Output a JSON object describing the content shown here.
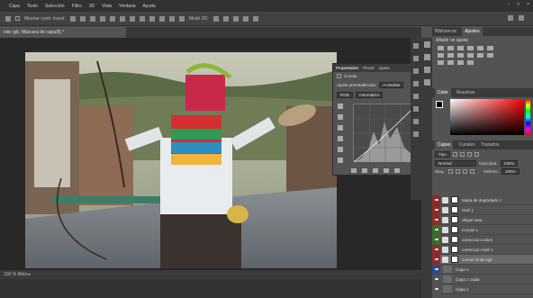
{
  "menubar": {
    "items": [
      "Capa",
      "Texto",
      "Selección",
      "Filtro",
      "3D",
      "Vista",
      "Ventana",
      "Ayuda"
    ],
    "window_controls": [
      "–",
      "□",
      "×"
    ]
  },
  "options_bar": {
    "checkbox_label": "Mostrar contr. transf.",
    "mode_label": "Modo 3D:"
  },
  "document": {
    "tab_title": "edo rgb, Máscara de capa/8) *",
    "status": "100 % 8bits ▸"
  },
  "properties": {
    "tabs": [
      "Propiedades",
      "Pincel",
      "Ajuste"
    ],
    "panel_name": "Curvas",
    "preset_label": "Ajuste preestablecido:",
    "preset_value": "A medida",
    "channel_value": "RGB",
    "auto_label": "Automático"
  },
  "right_panel": {
    "top_tabs": [
      "Bibliotecas",
      "Ajustes"
    ],
    "adjust_title": "Añadir un ajuste",
    "color_tabs": [
      "Color",
      "Muestras"
    ],
    "layers_tabs": [
      "Capas",
      "Canales",
      "Trazados"
    ],
    "kind_label": "Tipo",
    "blend_mode": "Normal",
    "opacity_label": "Opacidad:",
    "opacity_value": "100%",
    "lock_label": "Bloq.:",
    "fill_label": "Relleno:",
    "fill_value": "100%"
  },
  "layers": [
    {
      "name": "Mapa de degradado 1",
      "kind": "adjustment",
      "eye": "red"
    },
    {
      "name": "nivel 1",
      "kind": "adjustment",
      "eye": "red"
    },
    {
      "name": "ofeyte rana",
      "kind": "adjustment",
      "eye": "red"
    },
    {
      "name": "Curvas 1",
      "kind": "adjustment",
      "eye": "green"
    },
    {
      "name": "correccion colors",
      "kind": "adjustment",
      "eye": "green"
    },
    {
      "name": "correccion nivel 1",
      "kind": "adjustment",
      "eye": "red"
    },
    {
      "name": "curvas fondo rgb",
      "kind": "adjustment",
      "eye": "red",
      "selected": true
    },
    {
      "name": "Capa 1",
      "kind": "pixel",
      "eye": "blue"
    },
    {
      "name": "Capa 1 copia",
      "kind": "pixel",
      "eye": "gray"
    },
    {
      "name": "Capa 1",
      "kind": "pixel",
      "eye": "gray"
    }
  ],
  "colors": {
    "accent_red": "#8a2b2b",
    "accent_blue": "#2e4a8a",
    "accent_green": "#3a6a2e"
  }
}
